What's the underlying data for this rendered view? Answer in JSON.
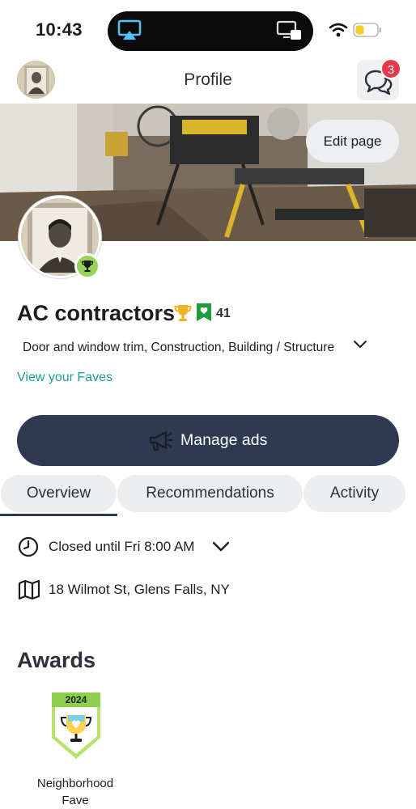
{
  "status_bar": {
    "time": "10:43"
  },
  "nav": {
    "title": "Profile",
    "message_badge_count": "3"
  },
  "cover": {
    "edit_button_label": "Edit page"
  },
  "business": {
    "name": "AC contractors",
    "fave_count": "41",
    "categories": "Door and window trim, Construction, Building / Structure",
    "view_faves_link": "View your Faves"
  },
  "actions": {
    "manage_ads_label": "Manage ads"
  },
  "tabs": [
    {
      "label": "Overview",
      "active": true
    },
    {
      "label": "Recommendations",
      "active": false
    },
    {
      "label": "Activity",
      "active": false
    }
  ],
  "details": {
    "hours": "Closed until Fri 8:00 AM",
    "address": "18 Wilmot St, Glens Falls, NY"
  },
  "awards": {
    "heading": "Awards",
    "items": [
      {
        "year": "2024",
        "label_line1": "Neighborhood",
        "label_line2": "Fave"
      }
    ]
  },
  "colors": {
    "accent_teal": "#1c9c94",
    "button_navy": "#2d3a52",
    "badge_red": "#e5394b",
    "award_green": "#9ad35a"
  },
  "icons": [
    "airplay-icon",
    "screen-mirror-icon",
    "wifi-icon",
    "battery-icon",
    "chat-icon",
    "trophy-icon",
    "fave-icon",
    "chevron-down-icon",
    "megaphone-icon",
    "clock-icon",
    "map-icon",
    "award-icon"
  ]
}
